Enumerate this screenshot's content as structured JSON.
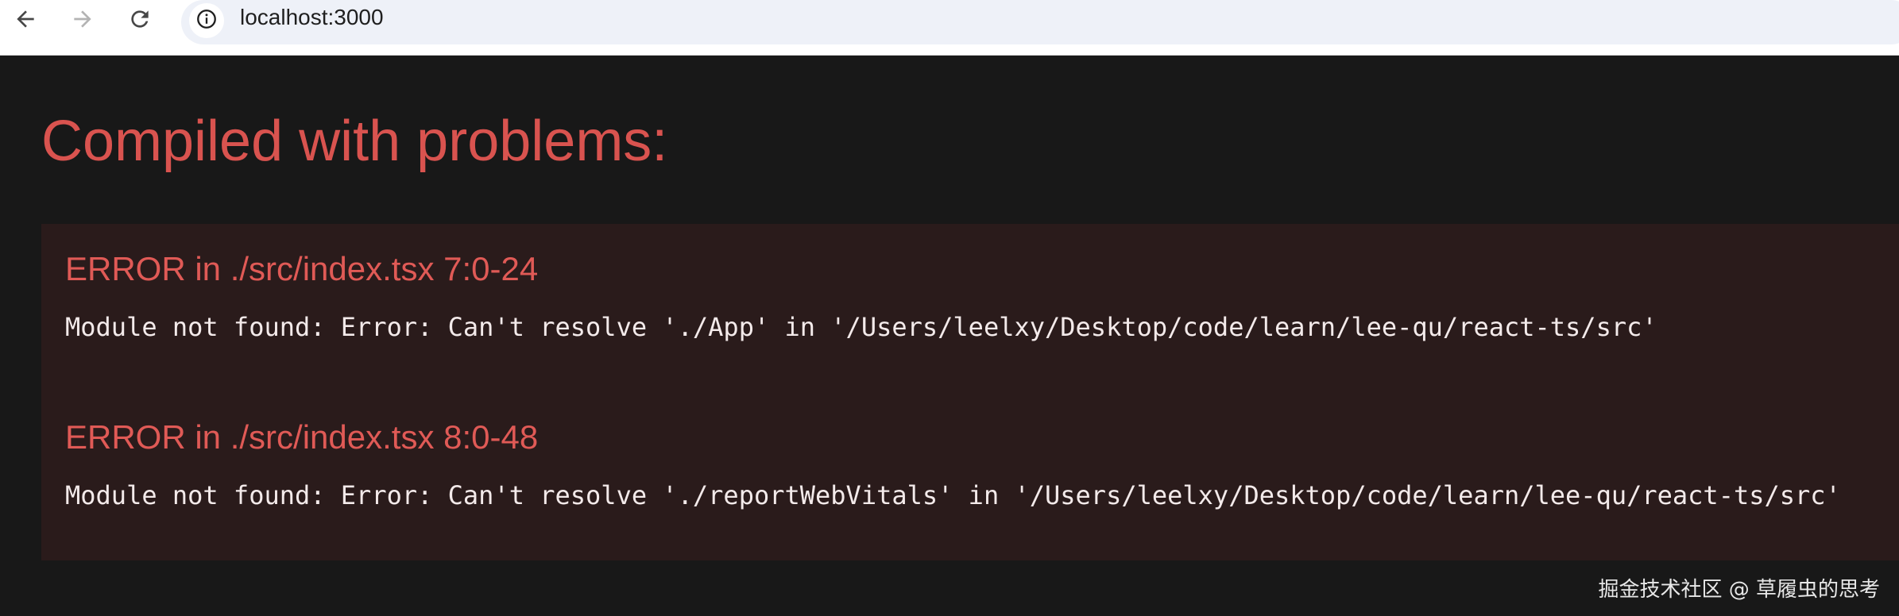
{
  "browser": {
    "url": "localhost:3000",
    "icons": {
      "back": "arrow-left-icon",
      "forward": "arrow-right-icon",
      "reload": "reload-icon",
      "site_info": "info-icon"
    }
  },
  "overlay": {
    "title": "Compiled with problems:",
    "errors": [
      {
        "header": "ERROR in ./src/index.tsx 7:0-24",
        "message": "Module not found: Error: Can't resolve './App' in '/Users/leelxy/Desktop/code/learn/lee-qu/react-ts/src'"
      },
      {
        "header": "ERROR in ./src/index.tsx 8:0-48",
        "message": "Module not found: Error: Can't resolve './reportWebVitals' in '/Users/leelxy/Desktop/code/learn/lee-qu/react-ts/src'"
      }
    ]
  },
  "watermark": "掘金技术社区 @ 草履虫的思考",
  "colors": {
    "overlay_background": "#181818",
    "error_panel_background": "#2a1b1b",
    "error_red": "#e05a56",
    "message_text": "#f3eaea"
  }
}
